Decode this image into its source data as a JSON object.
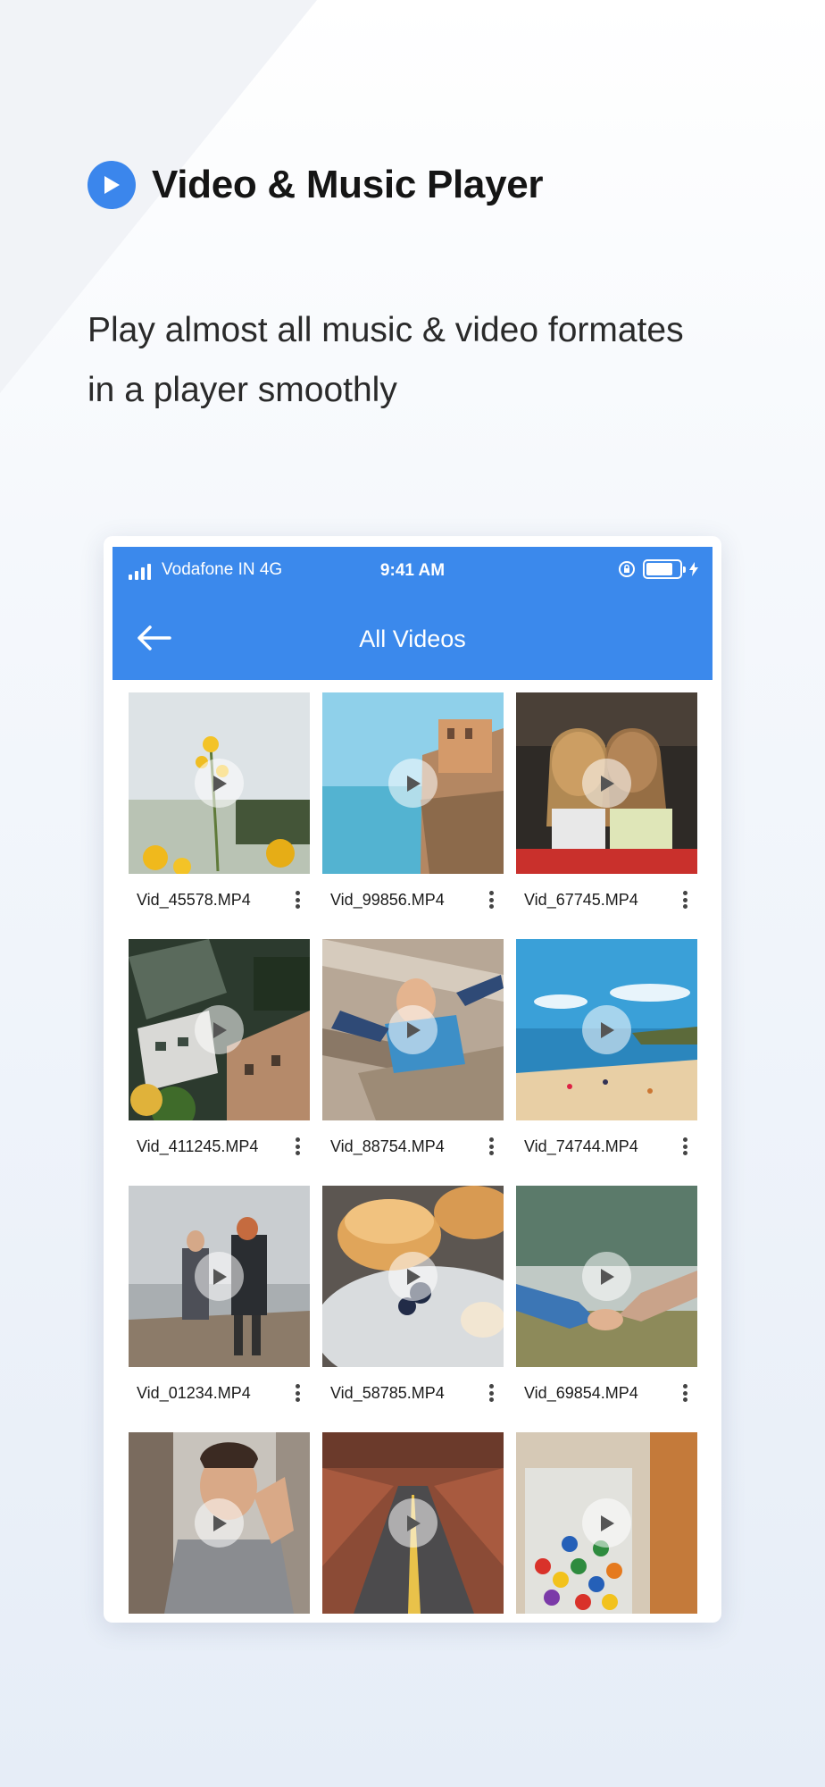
{
  "headline": {
    "title": "Video & Music Player",
    "accent": "#3b86ec"
  },
  "subtitle": {
    "line1": "Play almost all music & video formates",
    "line2": "in a player smoothly"
  },
  "status": {
    "carrier": "Vodafone IN 4G",
    "time": "9:41 AM",
    "battery_level": 0.8
  },
  "toolbar": {
    "title": "All Videos",
    "back_icon": "arrow-left-icon",
    "color": "#3b89ec"
  },
  "videos": [
    {
      "name": "Vid_45578.MP4"
    },
    {
      "name": "Vid_99856.MP4"
    },
    {
      "name": "Vid_67745.MP4"
    },
    {
      "name": "Vid_411245.MP4"
    },
    {
      "name": "Vid_88754.MP4"
    },
    {
      "name": "Vid_74744.MP4"
    },
    {
      "name": "Vid_01234.MP4"
    },
    {
      "name": "Vid_58785.MP4"
    },
    {
      "name": "Vid_69854.MP4"
    },
    {
      "name": ""
    },
    {
      "name": ""
    },
    {
      "name": ""
    }
  ]
}
